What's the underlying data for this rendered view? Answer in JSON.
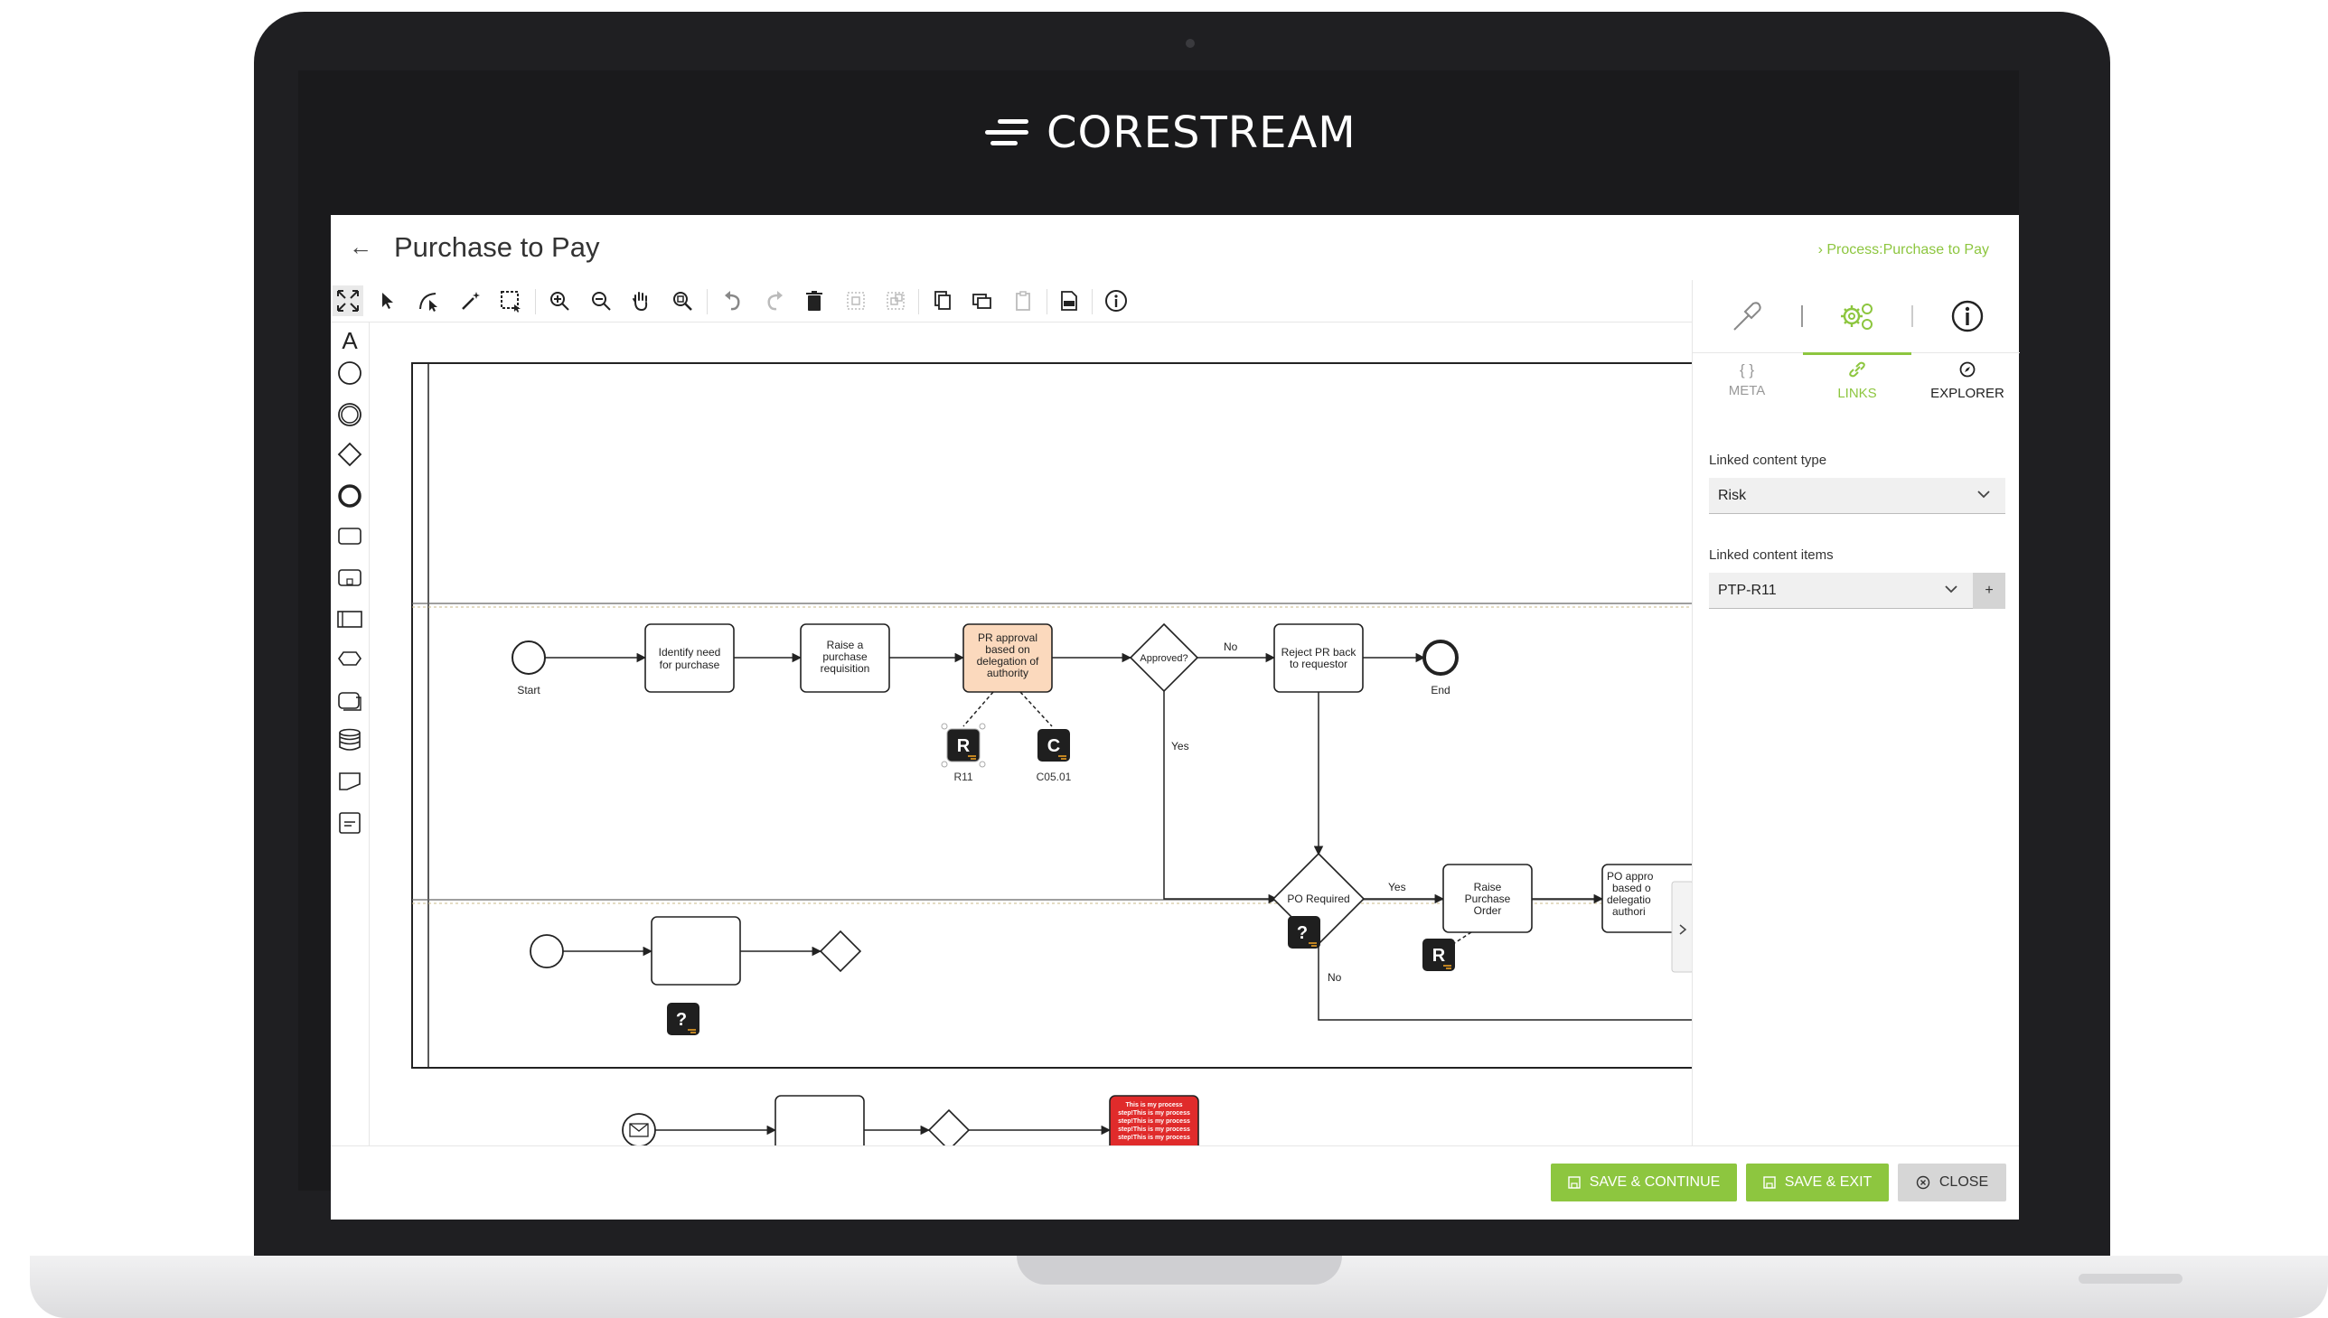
{
  "brand": {
    "name": "CORESTREAM"
  },
  "page": {
    "title": "Purchase to Pay",
    "breadcrumb": "› Process:Purchase to Pay"
  },
  "diagram": {
    "lane1": {
      "start": "Start",
      "task1": [
        "Identify need",
        "for purchase"
      ],
      "task2": [
        "Raise a",
        "purchase",
        "requisition"
      ],
      "task3": [
        "PR approval",
        "based on",
        "delegation of",
        "authority"
      ],
      "gateway": "Approved?",
      "no_label": "No",
      "yes_label": "Yes",
      "reject": [
        "Reject PR back",
        "to requestor"
      ],
      "end": "End",
      "badge_r": "R",
      "badge_r_label": "R11",
      "badge_c": "C",
      "badge_c_label": "C05.01"
    },
    "lane2": {
      "gateway": "PO Required",
      "yes_label": "Yes",
      "no_label": "No",
      "task": [
        "Raise",
        "Purchase",
        "Order"
      ],
      "task_cut": [
        "PO appro",
        "based o",
        "delegatio",
        "authori"
      ],
      "badge_q": "?",
      "badge_r": "R"
    },
    "lane3": {
      "badge_q": "?"
    },
    "bottom": {
      "red_text": [
        "This is my process",
        "step!This is my process",
        "step!This is my process",
        "step!This is my process",
        "step!This is my process"
      ]
    }
  },
  "panel": {
    "tabs": [
      "META",
      "LINKS",
      "EXPLORER"
    ],
    "active_tab": "LINKS",
    "linked_type_label": "Linked content type",
    "linked_type_value": "Risk",
    "linked_items_label": "Linked content items",
    "linked_items_value": "PTP-R11",
    "add": "+"
  },
  "footer": {
    "save_continue": "SAVE & CONTINUE",
    "save_exit": "SAVE & EXIT",
    "close": "CLOSE"
  },
  "colors": {
    "accent": "#8dc63f",
    "highlight_task": "#fbd9bd",
    "error": "#e02b2b",
    "bezel": "#1f1f22"
  }
}
